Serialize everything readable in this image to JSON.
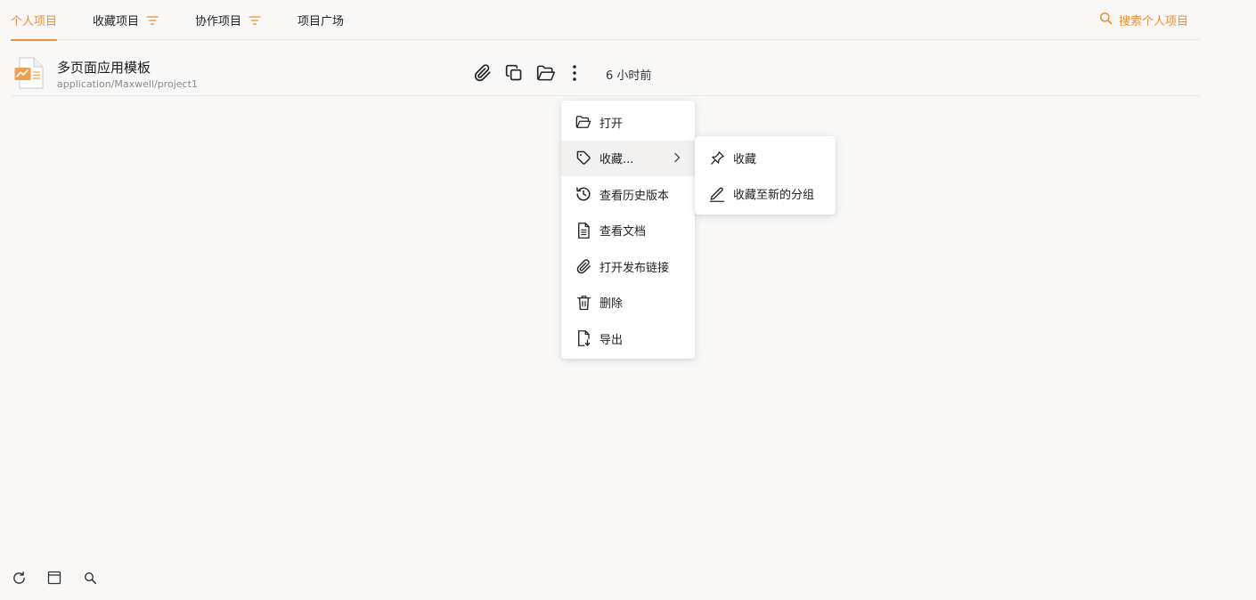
{
  "tabs": [
    {
      "label": "个人项目",
      "active": true
    },
    {
      "label": "收藏项目",
      "filter": true
    },
    {
      "label": "协作项目",
      "filter": true
    },
    {
      "label": "项目广场"
    }
  ],
  "search": {
    "label": "搜索个人项目",
    "icon": "search-icon"
  },
  "project": {
    "name": "多页面应用模板",
    "path": "application/Maxwell/project1",
    "time": "6 小时前",
    "actions": [
      "paperclip-icon",
      "copy-icon",
      "folder-open-icon",
      "more-vertical-icon"
    ]
  },
  "context_menu": {
    "items": [
      {
        "label": "打开",
        "icon": "folder-open-icon"
      },
      {
        "label": "收藏...",
        "icon": "tag-icon",
        "submenu": true
      },
      {
        "label": "查看历史版本",
        "icon": "history-icon"
      },
      {
        "label": "查看文档",
        "icon": "document-icon"
      },
      {
        "label": "打开发布链接",
        "icon": "paperclip-icon"
      },
      {
        "label": "删除",
        "icon": "trash-icon"
      },
      {
        "label": "导出",
        "icon": "export-file-icon"
      }
    ]
  },
  "submenu": {
    "items": [
      {
        "label": "收藏",
        "icon": "pin-icon"
      },
      {
        "label": "收藏至新的分组",
        "icon": "pen-icon"
      }
    ]
  },
  "bottom_bar": [
    "refresh-icon",
    "window-icon",
    "search-icon"
  ],
  "colors": {
    "accent": "#e8903a",
    "background": "#f9f8f6",
    "border": "#ebe9e5"
  }
}
